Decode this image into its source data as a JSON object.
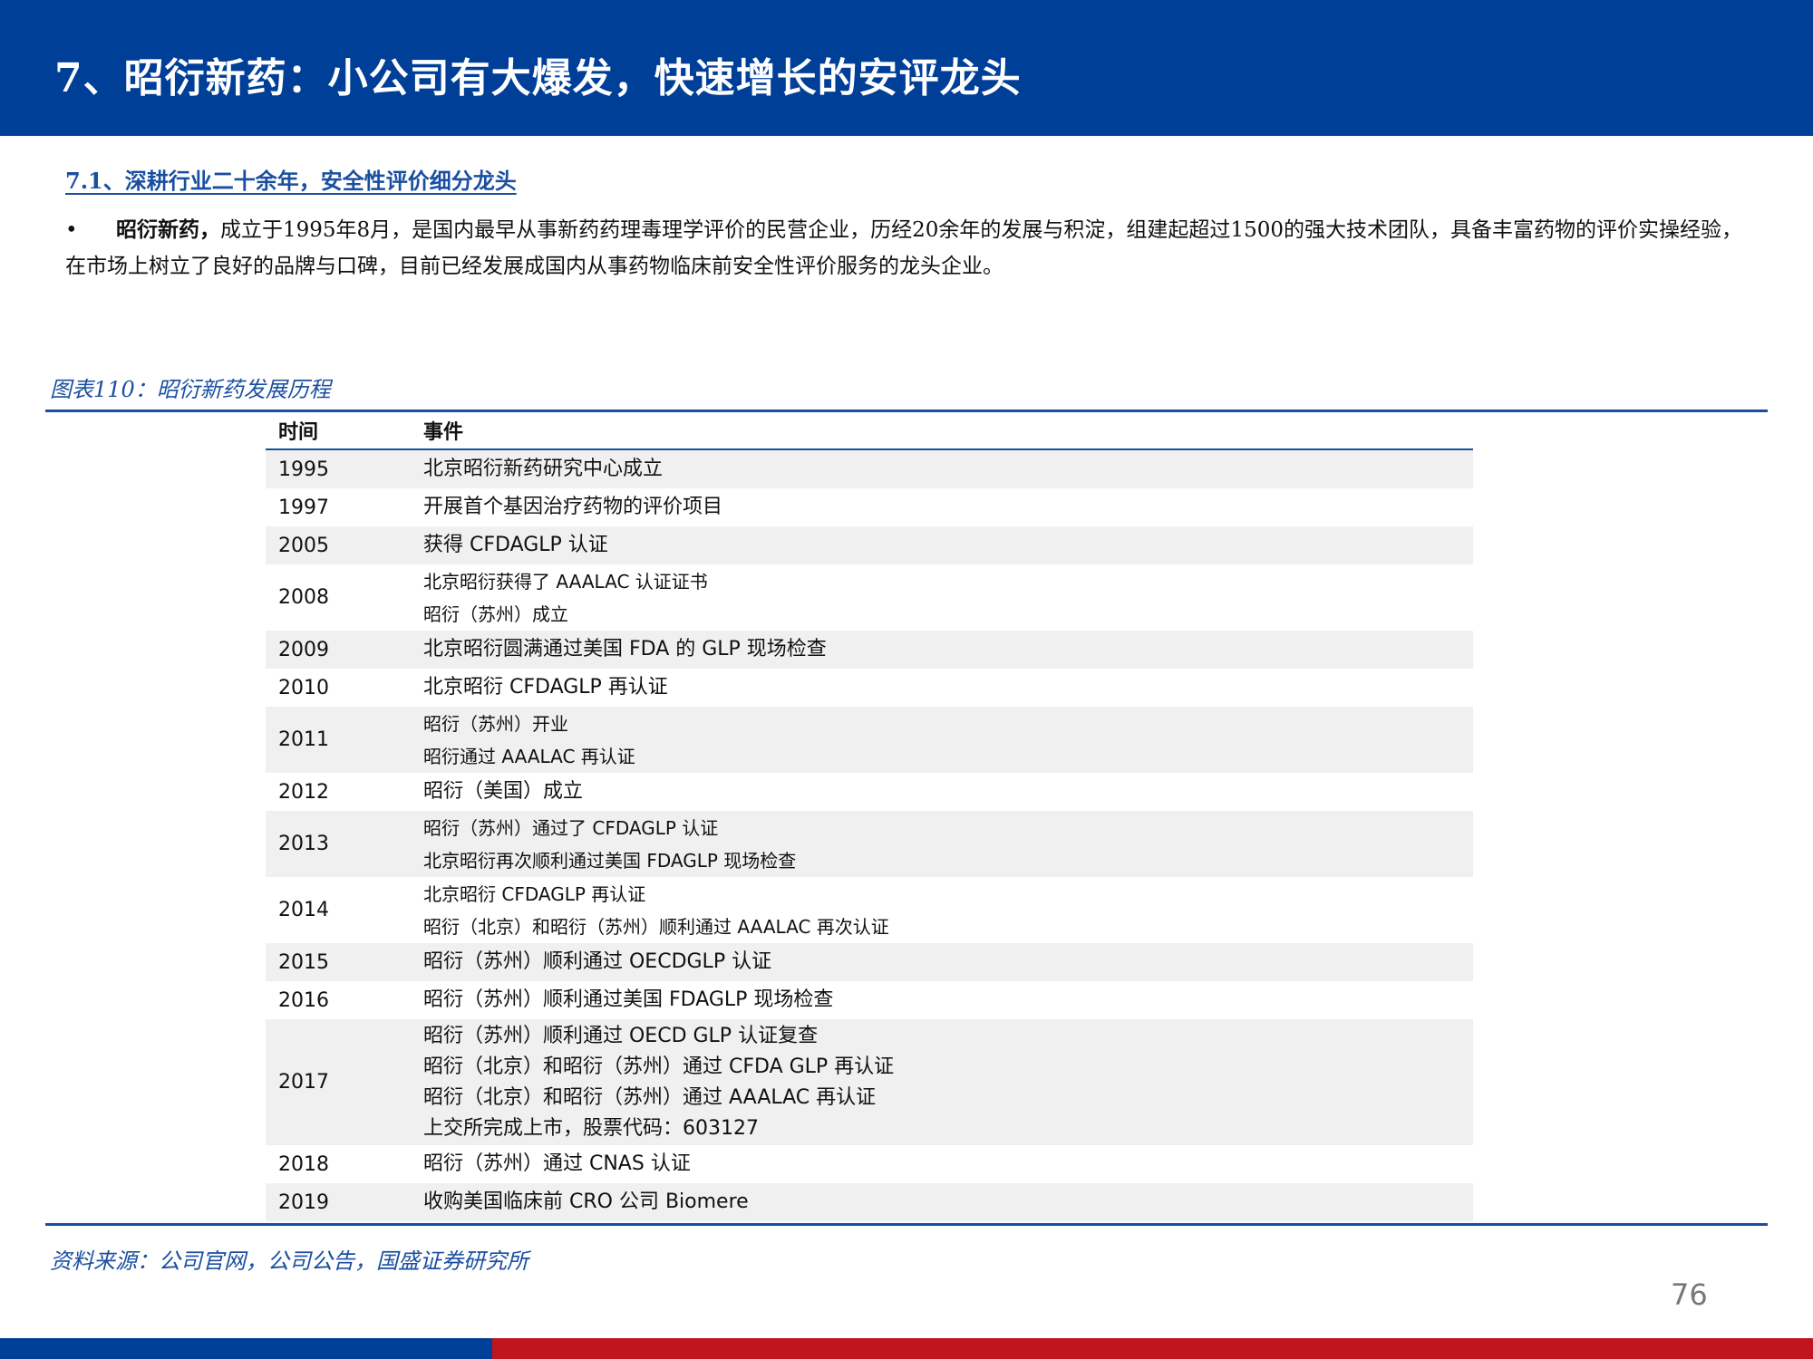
{
  "header": {
    "title": "7、昭衍新药：小公司有大爆发，快速增长的安评龙头"
  },
  "section": {
    "subtitle": "7.1、深耕行业二十余年，安全性评价细分龙头",
    "bullet": "•",
    "bold_lead": "昭衍新药，",
    "text": "成立于1995年8月，是国内最早从事新药药理毒理学评价的民营企业，历经20余年的发展与积淀，组建起超过1500的强大技术团队，具备丰富药物的评价实操经验，在市场上树立了良好的品牌与口碑，目前已经发展成国内从事药物临床前安全性评价服务的龙头企业。"
  },
  "figure": {
    "caption": "图表110：昭衍新药发展历程",
    "columns": [
      "时间",
      "事件"
    ],
    "rows": [
      {
        "year": "1995",
        "events": [
          "北京昭衍新药研究中心成立"
        ]
      },
      {
        "year": "1997",
        "events": [
          "开展首个基因治疗药物的评价项目"
        ]
      },
      {
        "year": "2005",
        "events": [
          "获得 CFDAGLP 认证"
        ]
      },
      {
        "year": "2008",
        "events": [
          "北京昭衍获得了 AAALAC 认证证书",
          "昭衍（苏州）成立"
        ]
      },
      {
        "year": "2009",
        "events": [
          "北京昭衍圆满通过美国 FDA 的 GLP 现场检查"
        ]
      },
      {
        "year": "2010",
        "events": [
          "北京昭衍 CFDAGLP 再认证"
        ]
      },
      {
        "year": "2011",
        "events": [
          "昭衍（苏州）开业",
          "昭衍通过 AAALAC 再认证"
        ]
      },
      {
        "year": "2012",
        "events": [
          "昭衍（美国）成立"
        ]
      },
      {
        "year": "2013",
        "events": [
          "昭衍（苏州）通过了 CFDAGLP 认证",
          "北京昭衍再次顺利通过美国 FDAGLP 现场检查"
        ]
      },
      {
        "year": "2014",
        "events": [
          "北京昭衍 CFDAGLP 再认证",
          "昭衍（北京）和昭衍（苏州）顺利通过 AAALAC 再次认证"
        ]
      },
      {
        "year": "2015",
        "events": [
          "昭衍（苏州）顺利通过 OECDGLP 认证"
        ]
      },
      {
        "year": "2016",
        "events": [
          "昭衍（苏州）顺利通过美国 FDAGLP 现场检查"
        ]
      },
      {
        "year": "2017",
        "events": [
          "昭衍（苏州）顺利通过 OECD GLP 认证复查",
          "昭衍（北京）和昭衍（苏州）通过 CFDA GLP 再认证",
          "昭衍（北京）和昭衍（苏州）通过 AAALAC 再认证",
          "上交所完成上市，股票代码：603127"
        ]
      },
      {
        "year": "2018",
        "events": [
          "昭衍（苏州）通过 CNAS 认证"
        ]
      },
      {
        "year": "2019",
        "events": [
          "收购美国临床前 CRO 公司 Biomere"
        ]
      }
    ],
    "source": "资料来源：公司官网，公司公告，国盛证券研究所"
  },
  "page_number": "76",
  "colors": {
    "brand_blue": "#003f98",
    "accent_red": "#c0141e",
    "text_blue": "#1a4fa0",
    "row_grey": "#f0f0f0"
  }
}
